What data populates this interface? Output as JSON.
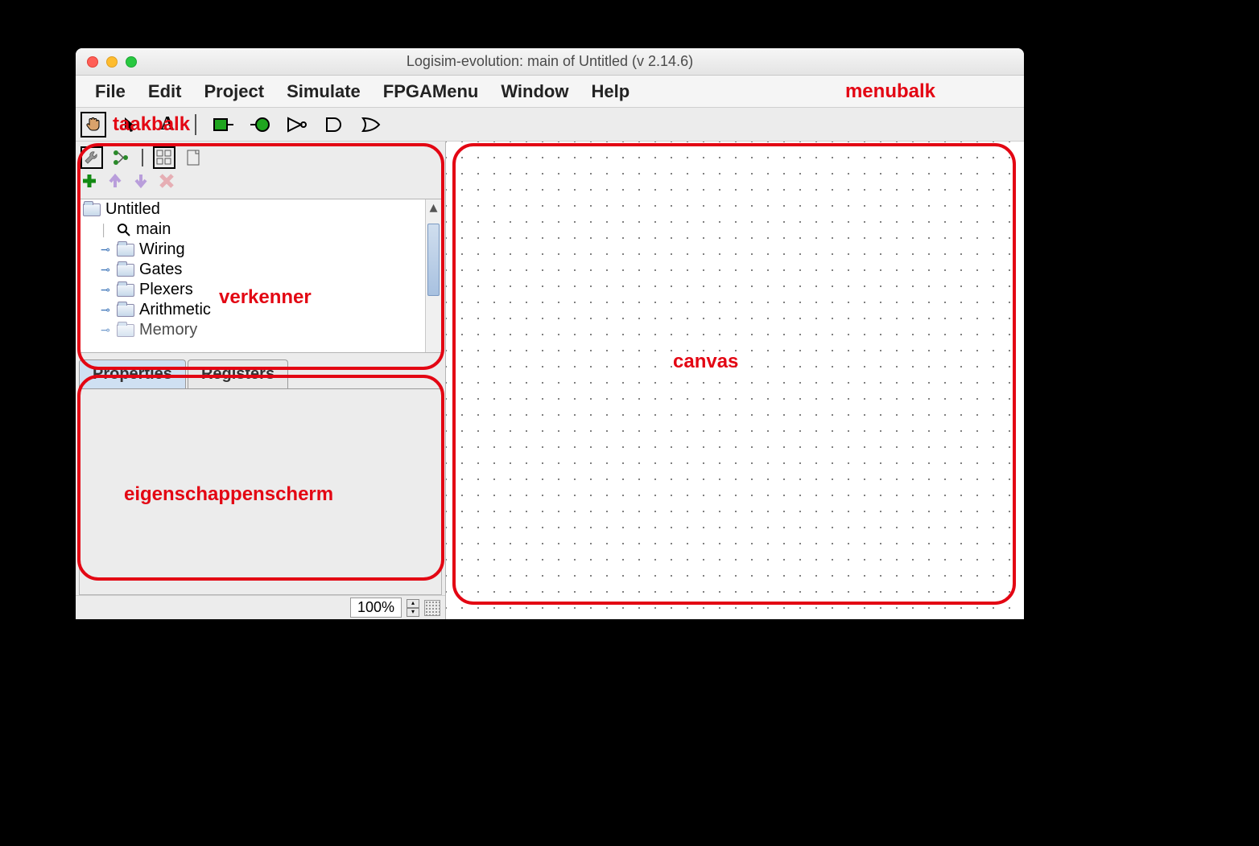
{
  "window": {
    "title": "Logisim-evolution: main of Untitled (v 2.14.6)"
  },
  "menubar": {
    "items": [
      "File",
      "Edit",
      "Project",
      "Simulate",
      "FPGAMenu",
      "Window",
      "Help"
    ]
  },
  "toolbar": {
    "tools": [
      {
        "name": "poke-tool",
        "selected": true
      },
      {
        "name": "select-tool"
      },
      {
        "name": "text-tool"
      },
      {
        "name": "separator"
      },
      {
        "name": "input-pin-tool"
      },
      {
        "name": "output-pin-tool"
      },
      {
        "name": "not-gate-tool"
      },
      {
        "name": "and-gate-tool"
      },
      {
        "name": "or-gate-tool"
      }
    ]
  },
  "explorer": {
    "view_buttons": [
      {
        "name": "toolbox-view"
      },
      {
        "name": "simulation-view"
      },
      {
        "name": "appearance-view",
        "boxed": true
      },
      {
        "name": "layout-view"
      }
    ],
    "action_buttons": [
      {
        "name": "add",
        "color": "#138a13",
        "glyph": "plus"
      },
      {
        "name": "move-up",
        "color": "#c5b0e0",
        "glyph": "arrow-up"
      },
      {
        "name": "move-down",
        "color": "#c5b0e0",
        "glyph": "arrow-down"
      },
      {
        "name": "delete",
        "color": "#e6aeb4",
        "glyph": "cross"
      }
    ],
    "tree": {
      "root": "Untitled",
      "children": [
        {
          "label": "main",
          "icon": "magnify"
        },
        {
          "label": "Wiring",
          "icon": "folder",
          "expandable": true
        },
        {
          "label": "Gates",
          "icon": "folder",
          "expandable": true
        },
        {
          "label": "Plexers",
          "icon": "folder",
          "expandable": true
        },
        {
          "label": "Arithmetic",
          "icon": "folder",
          "expandable": true
        },
        {
          "label": "Memory",
          "icon": "folder",
          "expandable": true
        }
      ]
    }
  },
  "tabs": {
    "items": [
      "Properties",
      "Registers"
    ],
    "active": 0
  },
  "zoom": {
    "value": "100%"
  },
  "annotations": {
    "menubalk": "menubalk",
    "taakbalk": "taakbalk",
    "verkenner": "verkenner",
    "eigenschappenscherm": "eigenschappenscherm",
    "canvas": "canvas"
  }
}
